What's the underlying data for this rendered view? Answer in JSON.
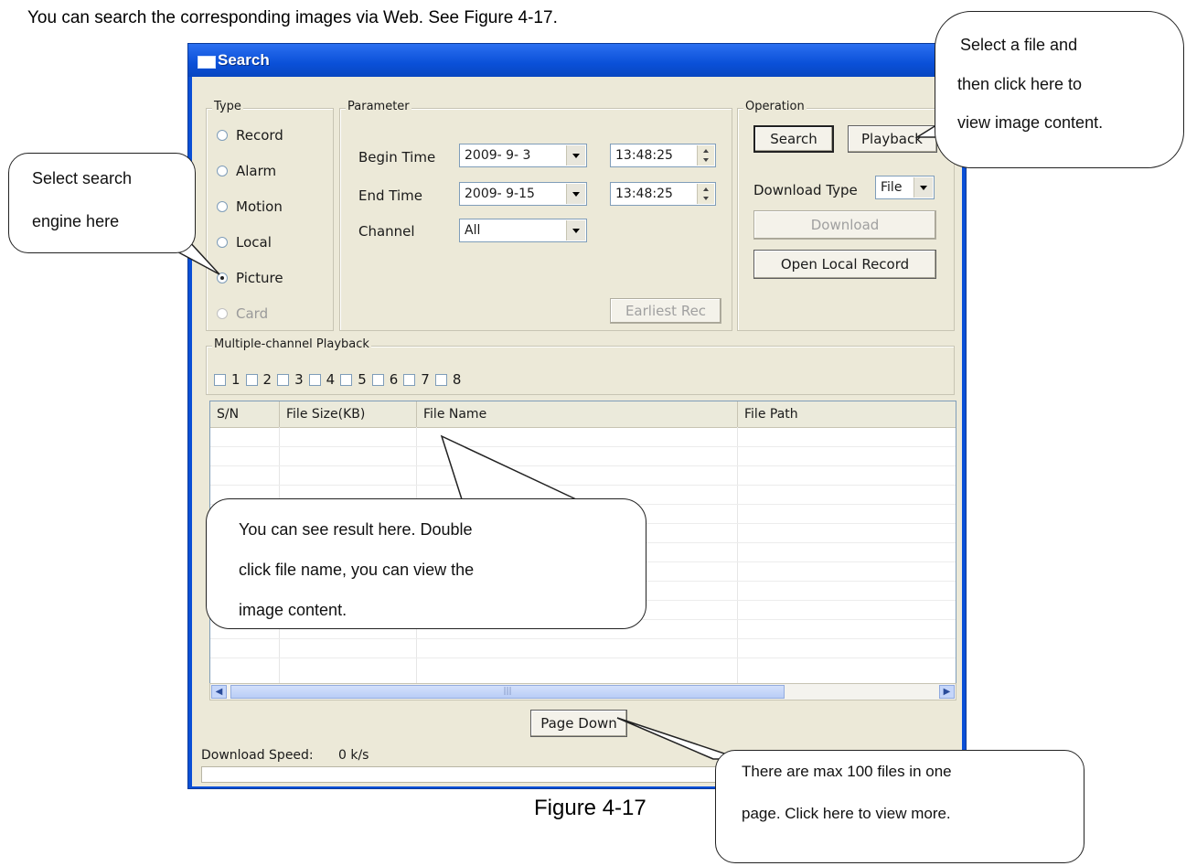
{
  "intro_text": "You can search the corresponding images via Web. See Figure 4-17.",
  "caption": "Figure 4-17",
  "window": {
    "title": "Search",
    "type_group": {
      "legend": "Type",
      "options": [
        "Record",
        "Alarm",
        "Motion",
        "Local",
        "Picture",
        "Card"
      ],
      "selected": "Picture",
      "disabled": [
        "Card"
      ]
    },
    "parameter": {
      "legend": "Parameter",
      "begin_label": "Begin Time",
      "begin_date": "2009- 9- 3",
      "begin_time": "13:48:25",
      "end_label": "End Time",
      "end_date": "2009- 9-15",
      "end_time": "13:48:25",
      "channel_label": "Channel",
      "channel_value": "All",
      "earliest_button": "Earliest Rec"
    },
    "operation": {
      "legend": "Operation",
      "search_button": "Search",
      "playback_button": "Playback",
      "download_type_label": "Download Type",
      "download_type_value": "File",
      "download_button": "Download",
      "open_local_button": "Open Local Record"
    },
    "multi_playback": {
      "legend": "Multiple-channel Playback",
      "channels": [
        "1",
        "2",
        "3",
        "4",
        "5",
        "6",
        "7",
        "8"
      ]
    },
    "table": {
      "columns": [
        "S/N",
        "File Size(KB)",
        "File Name",
        "File Path"
      ]
    },
    "page_down_button": "Page Down",
    "download_speed_label": "Download Speed:",
    "download_speed_value": "0 k/s"
  },
  "callouts": {
    "select_file": [
      "Select a file and",
      "then click here to",
      "view image content."
    ],
    "search_engine": [
      "Select search",
      "engine here"
    ],
    "result": [
      "You can see result here. Double",
      "click file name, you can view the",
      "image content."
    ],
    "max_files": [
      "There are max 100 files in one",
      "page. Click here to view more."
    ]
  }
}
